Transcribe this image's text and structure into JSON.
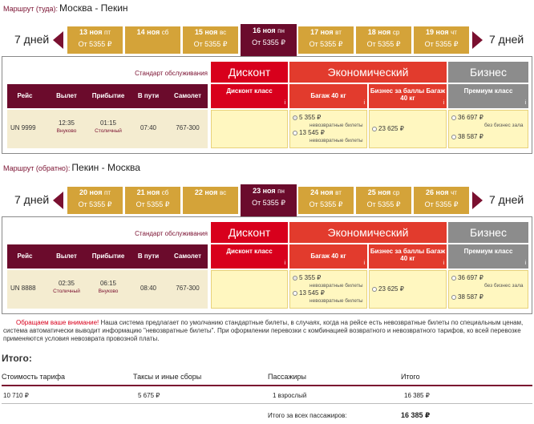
{
  "outbound": {
    "label": "Маршрут (туда):",
    "route": "Москва - Пекин",
    "prev_days": "7 дней",
    "next_days": "7 дней",
    "dates": [
      {
        "day": "13 ноя",
        "dow": "пт",
        "price": "От 5355 ₽"
      },
      {
        "day": "14 ноя",
        "dow": "сб",
        "price": ""
      },
      {
        "day": "15 ноя",
        "dow": "вс",
        "price": "От 5355 ₽"
      },
      {
        "day": "16 ноя",
        "dow": "пн",
        "price": "От 5355 ₽"
      },
      {
        "day": "17 ноя",
        "dow": "вт",
        "price": "От 5355 ₽"
      },
      {
        "day": "18 ноя",
        "dow": "ср",
        "price": "От 5355 ₽"
      },
      {
        "day": "19 ноя",
        "dow": "чт",
        "price": "От 5355 ₽"
      }
    ],
    "flight": {
      "number": "UN 9999",
      "dep_time": "12:35",
      "dep_airport": "Внуково",
      "arr_time": "01:15",
      "arr_airport": "Столичный",
      "duration": "07:40",
      "aircraft": "767-300"
    }
  },
  "return": {
    "label": "Маршрут (обратно):",
    "route": "Пекин - Москва",
    "prev_days": "7 дней",
    "next_days": "7 дней",
    "dates": [
      {
        "day": "20 ноя",
        "dow": "пт",
        "price": "От 5355 ₽"
      },
      {
        "day": "21 ноя",
        "dow": "сб",
        "price": "От 5355 ₽"
      },
      {
        "day": "22 ноя",
        "dow": "вс",
        "price": ""
      },
      {
        "day": "23 ноя",
        "dow": "пн",
        "price": "От 5355 ₽"
      },
      {
        "day": "24 ноя",
        "dow": "вт",
        "price": "От 5355 ₽"
      },
      {
        "day": "25 ноя",
        "dow": "ср",
        "price": "От 5355 ₽"
      },
      {
        "day": "26 ноя",
        "dow": "чт",
        "price": "От 5355 ₽"
      }
    ],
    "flight": {
      "number": "UN 8888",
      "dep_time": "02:35",
      "dep_airport": "Столичный",
      "arr_time": "06:15",
      "arr_airport": "Внуково",
      "duration": "08:40",
      "aircraft": "767-300"
    }
  },
  "table": {
    "service_standard": "Стандарт обслуживания",
    "discount": "Дисконт",
    "economy": "Экономический",
    "business": "Бизнес",
    "sub_discount": "Дисконт класс",
    "sub_bag40": "Багаж 40 кг",
    "sub_points": "Бизнес за баллы Багаж 40 кг",
    "sub_premium": "Премиум класс",
    "info": "i",
    "col_flight": "Рейс",
    "col_dep": "Вылет",
    "col_arr": "Прибытие",
    "col_way": "В пути",
    "col_plane": "Самолет",
    "fare_5355": "5 355 ₽",
    "fare_13545": "13 545 ₽",
    "nonref": "невозвратные билеты",
    "fare_23625": "23 625 ₽",
    "fare_36697": "36 697 ₽",
    "no_lounge": "без бизнес зала",
    "fare_38587": "38 587 ₽"
  },
  "notice": {
    "attention": "Обращаем ваше внимание!",
    "text": " Наша система предлагает по умолчанию стандартные билеты, в случаях, когда на рейсе есть невозвратные билеты по специальным ценам, система автоматически выводит информацию \"невозвратные билеты\". При оформлении перевозки с комбинацией возвратного и невозвратного тарифов, ко всей перевозке применяются условия невозврата провозной платы."
  },
  "summary": {
    "title": "Итого:",
    "h_fare": "Стоимость тарифа",
    "h_taxes": "Таксы и иные сборы",
    "h_pax": "Пассажиры",
    "h_total": "Итого",
    "v_fare": "10 710 ₽",
    "v_taxes": "5 675 ₽",
    "v_pax": "1 взрослый",
    "v_total": "16 385 ₽",
    "all_label": "Итого за всех пассажиров:",
    "all_total": "16 385 ₽"
  }
}
